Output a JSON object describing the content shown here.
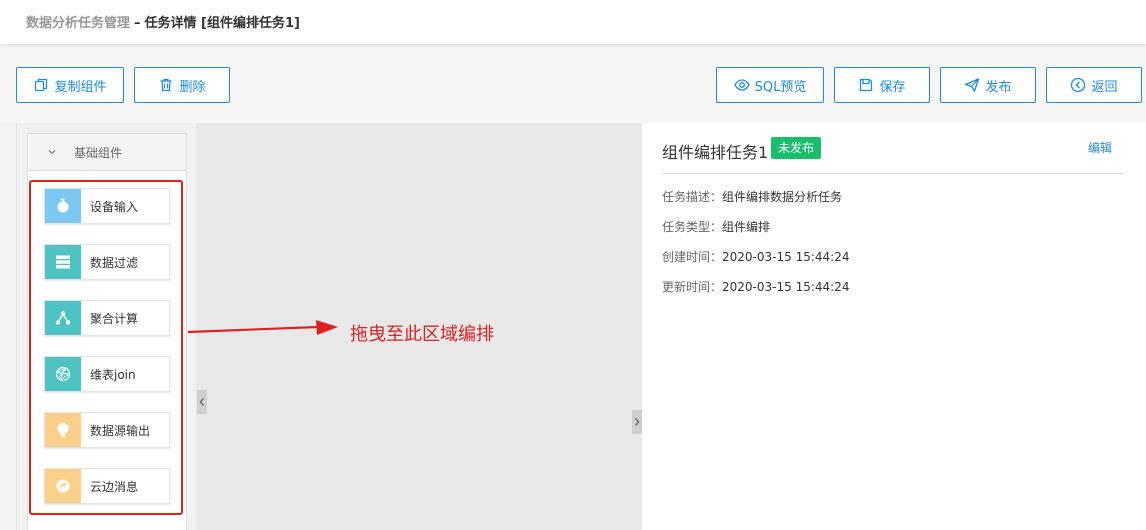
{
  "breadcrumb": {
    "root": "数据分析任务管理",
    "separator": "–",
    "current": "任务详情 [组件编排任务1]"
  },
  "toolbar": {
    "copy_label": "复制组件",
    "delete_label": "删除",
    "sql_preview_label": "SQL预览",
    "save_label": "保存",
    "publish_label": "发布",
    "back_label": "返回"
  },
  "sidebar": {
    "group_title": "基础组件",
    "components": [
      {
        "label": "设备输入",
        "icon": "device-input-icon",
        "color": "#7cc8f2"
      },
      {
        "label": "数据过滤",
        "icon": "data-filter-icon",
        "color": "#4dc3c3"
      },
      {
        "label": "聚合计算",
        "icon": "aggregate-icon",
        "color": "#4dc3c3"
      },
      {
        "label": "维表join",
        "icon": "dimension-join-icon",
        "color": "#4dc3c3"
      },
      {
        "label": "数据源输出",
        "icon": "datasource-output-icon",
        "color": "#fbd08a"
      },
      {
        "label": "云边消息",
        "icon": "cloud-edge-message-icon",
        "color": "#fbd08a"
      }
    ]
  },
  "canvas": {
    "drag_hint": "拖曳至此区域编排"
  },
  "details": {
    "task_name": "组件编排任务1",
    "status_badge": "未发布",
    "edit_label": "编辑",
    "fields": [
      {
        "key": "任务描述：",
        "value": "组件编排数据分析任务"
      },
      {
        "key": "任务类型：",
        "value": "组件编排"
      },
      {
        "key": "创建时间：",
        "value": "2020-03-15 15:44:24"
      },
      {
        "key": "更新时间：",
        "value": "2020-03-15 15:44:24"
      }
    ]
  },
  "colors": {
    "primary": "#1e8ae0",
    "status_unpublished": "#19be6b",
    "highlight": "#e02020"
  }
}
